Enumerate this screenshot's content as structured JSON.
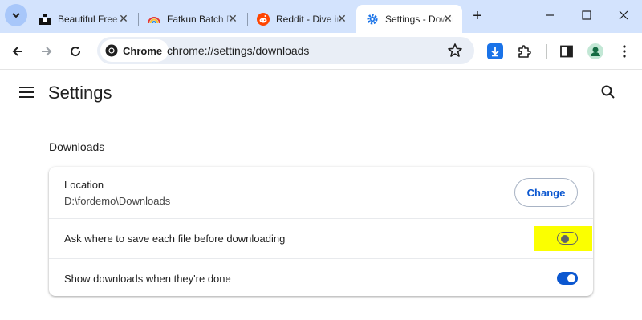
{
  "tabs": [
    {
      "title": "Beautiful Free Images",
      "icon": "unsplash-icon"
    },
    {
      "title": "Fatkun Batch Download",
      "icon": "rainbow-icon"
    },
    {
      "title": "Reddit - Dive into anything",
      "icon": "reddit-icon"
    },
    {
      "title": "Settings - Downloads",
      "icon": "gear-icon",
      "active": true
    }
  ],
  "toolbar": {
    "chip_label": "Chrome",
    "url": "chrome://settings/downloads"
  },
  "settings": {
    "title": "Settings"
  },
  "downloads": {
    "section_title": "Downloads",
    "location_label": "Location",
    "location_path": "D:\\fordemo\\Downloads",
    "change_button": "Change",
    "ask_label": "Ask where to save each file before downloading",
    "ask_enabled": false,
    "show_label": "Show downloads when they're done",
    "show_enabled": true
  },
  "colors": {
    "tabstrip": "#d3e3fd",
    "accent": "#0b57d0",
    "highlight": "#fbff00",
    "download_button": "#1a73e8"
  }
}
